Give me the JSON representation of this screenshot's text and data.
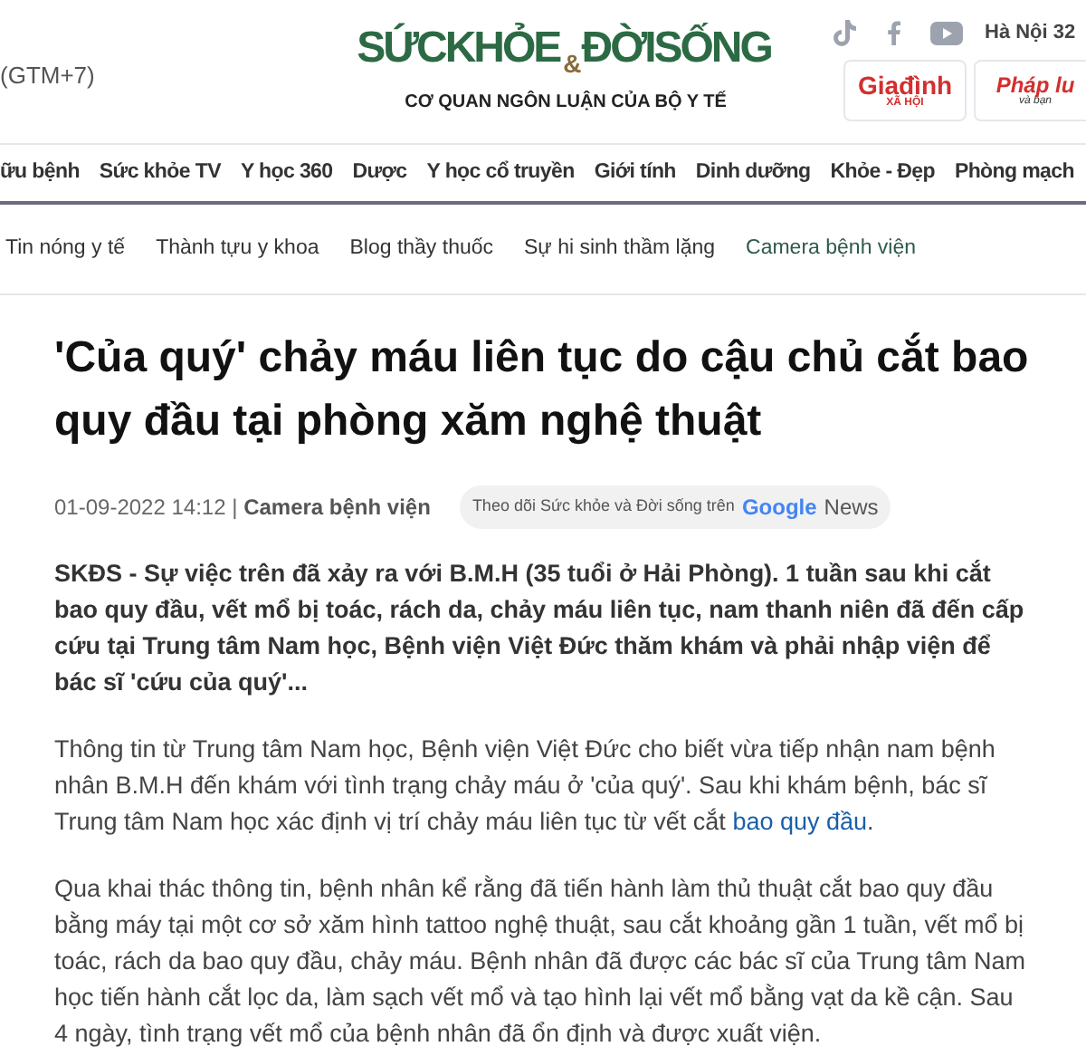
{
  "header": {
    "timezone": "(GTM+7)",
    "logo": {
      "part_1": "SỨCKHỎE",
      "ampersand": "&",
      "part_2": "ĐỜISỐNG",
      "tagline": "CƠ QUAN NGÔN LUẬN CỦA BỘ Y TẾ"
    },
    "weather": "Hà Nội 32",
    "partners": [
      {
        "name": "Giađình",
        "sub": "XÃ HỘI"
      },
      {
        "name": "Pháp lu",
        "sub": "và bạn"
      }
    ]
  },
  "nav": [
    {
      "label": "ữu bệnh"
    },
    {
      "label": "Sức khỏe TV"
    },
    {
      "label": "Y học 360"
    },
    {
      "label": "Dược"
    },
    {
      "label": "Y học cổ truyền"
    },
    {
      "label": "Giới tính"
    },
    {
      "label": "Dinh dưỡng"
    },
    {
      "label": "Khỏe - Đẹp"
    },
    {
      "label": "Phòng mạch"
    }
  ],
  "subnav": [
    {
      "label": "Tin nóng y tế",
      "selected": false
    },
    {
      "label": "Thành tựu y khoa",
      "selected": false
    },
    {
      "label": "Blog thầy thuốc",
      "selected": false
    },
    {
      "label": "Sự hi sinh thầm lặng",
      "selected": false
    },
    {
      "label": "Camera bệnh viện",
      "selected": true
    }
  ],
  "article": {
    "title": "'Của quý' chảy máu liên tục do cậu chủ cắt bao quy đầu tại phòng xăm nghệ thuật",
    "date": "01-09-2022 14:12",
    "separator": "|",
    "category": "Camera bệnh viện",
    "follow": {
      "text": "Theo dõi Sức khỏe và Đời sống trên",
      "brand": "Google",
      "product": "News"
    },
    "lead": "SKĐS - Sự việc trên đã xảy ra với B.M.H (35 tuổi ở Hải Phòng). 1 tuần sau khi cắt bao quy đầu, vết mổ bị toác, rách da, chảy máu liên tục, nam thanh niên đã đến cấp cứu tại Trung tâm Nam học, Bệnh viện Việt Đức thăm khám và phải nhập viện để bác sĩ 'cứu của quý'...",
    "paragraphs": [
      {
        "text": "Thông tin từ Trung tâm Nam học, Bệnh viện Việt Đức cho biết vừa tiếp nhận nam bệnh nhân B.M.H đến khám với tình trạng chảy máu ở 'của quý'. Sau khi khám bệnh, bác sĩ Trung tâm Nam học xác định vị trí chảy máu liên tục từ vết cắt",
        "link": "bao quy đầu",
        "tail": "."
      },
      {
        "text": "Qua khai thác thông tin, bệnh nhân kể rằng đã tiến hành làm thủ thuật cắt bao quy đầu bằng máy tại một cơ sở xăm hình tattoo nghệ thuật, sau cắt khoảng gần 1 tuần, vết mổ bị toác, rách da bao quy đầu, chảy máu. Bệnh nhân đã được các bác sĩ của Trung tâm Nam học tiến hành cắt lọc da, làm sạch vết mổ và tạo hình lại vết mổ bằng vạt da kề cận. Sau 4 ngày, tình trạng vết mổ của bệnh nhân đã ổn định và được xuất viện."
      }
    ]
  }
}
